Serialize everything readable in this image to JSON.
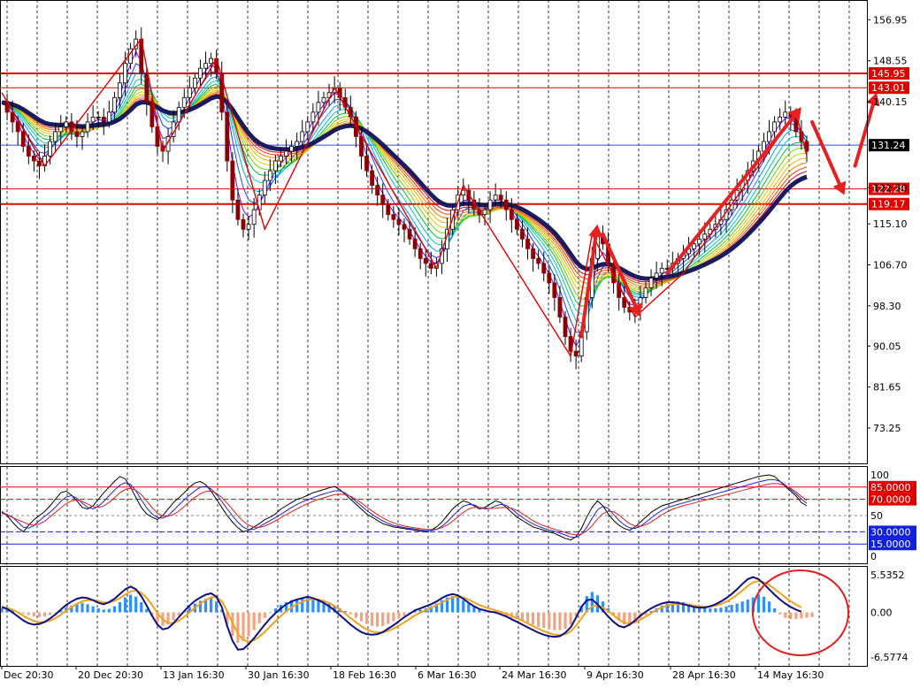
{
  "chart_data": [
    {
      "type": "candlestick",
      "panel": "price",
      "y_ticks": [
        "156.95",
        "148.55",
        "140.15",
        "122.50",
        "115.10",
        "106.70",
        "98.30",
        "90.05",
        "81.65",
        "73.25"
      ],
      "y_tick_values": [
        156.95,
        148.55,
        140.15,
        122.5,
        115.1,
        106.7,
        98.3,
        90.05,
        81.65,
        73.25
      ],
      "ylim": [
        66,
        161
      ],
      "grid": true,
      "current_price": {
        "label": "131.24",
        "value": 131.24
      },
      "horizontal_levels": [
        {
          "label": "145.95",
          "value": 145.95,
          "color": "#e00000"
        },
        {
          "label": "143.01",
          "value": 143.01,
          "color": "#e00000"
        },
        {
          "label": "122.28",
          "value": 122.28,
          "color": "#e00000"
        },
        {
          "label": "119.17",
          "value": 119.17,
          "color": "#e00000"
        }
      ],
      "zigzag_points": [
        {
          "bar": 0,
          "value": 142
        },
        {
          "bar": 8,
          "value": 127
        },
        {
          "bar": 26,
          "value": 153
        },
        {
          "bar": 30,
          "value": 130
        },
        {
          "bar": 40,
          "value": 149
        },
        {
          "bar": 49,
          "value": 114
        },
        {
          "bar": 62,
          "value": 143
        },
        {
          "bar": 81,
          "value": 106
        },
        {
          "bar": 86,
          "value": 123
        },
        {
          "bar": 106,
          "value": 88
        },
        {
          "bar": 110,
          "value": 113
        },
        {
          "bar": 118,
          "value": 96
        },
        {
          "bar": 127,
          "value": 105
        },
        {
          "bar": 148,
          "value": 138
        },
        {
          "bar": 150,
          "value": 129
        }
      ],
      "close_series": [
        140,
        138,
        136,
        134,
        131,
        129,
        128,
        127,
        129,
        132,
        134,
        135,
        136,
        134,
        133,
        134,
        136,
        137,
        137,
        136,
        138,
        141,
        144,
        148,
        151,
        153,
        146,
        140,
        135,
        131,
        130,
        133,
        136,
        139,
        141,
        143,
        145,
        147,
        148,
        149,
        146,
        138,
        128,
        120,
        116,
        114,
        115,
        118,
        121,
        124,
        126,
        128,
        129,
        130,
        131,
        132,
        134,
        136,
        138,
        140,
        141,
        142,
        143,
        141,
        139,
        137,
        133,
        129,
        126,
        123,
        121,
        119,
        117,
        116,
        115,
        114,
        112,
        110,
        108,
        107,
        106,
        107,
        110,
        114,
        118,
        121,
        122,
        120,
        118,
        117,
        118,
        120,
        121,
        120,
        118,
        116,
        114,
        112,
        110,
        108,
        107,
        105,
        103,
        100,
        96,
        92,
        89,
        88,
        93,
        100,
        108,
        113,
        111,
        107,
        103,
        100,
        98,
        97,
        98,
        100,
        102,
        104,
        105,
        106,
        106,
        107,
        108,
        109,
        110,
        111,
        112,
        113,
        114,
        115,
        116,
        118,
        120,
        122,
        124,
        126,
        128,
        130,
        132,
        134,
        136,
        137,
        138,
        137,
        134,
        132,
        130
      ],
      "ma_ribbon_count": 12,
      "thick_ma_color": "#1a1a5e",
      "arrows": [
        {
          "from_bar": 108,
          "from_value": 92,
          "to_bar": 111,
          "to_value": 115
        },
        {
          "from_bar": 112,
          "from_value": 113,
          "to_bar": 119,
          "to_value": 96
        },
        {
          "from_bar": 124,
          "from_value": 105,
          "to_bar": 149,
          "to_value": 139
        },
        {
          "from_bar": 151,
          "from_value": 136,
          "to_bar": 157,
          "to_value": 121
        },
        {
          "from_bar": 159,
          "from_value": 127,
          "to_bar": 163,
          "to_value": 142
        }
      ]
    },
    {
      "type": "line",
      "panel": "oscillator",
      "y_ticks": [
        "100",
        "50",
        "0"
      ],
      "ylim": [
        0,
        100
      ],
      "levels": [
        {
          "label": "85.0000",
          "value": 85,
          "color": "#e00000"
        },
        {
          "label": "70.0000",
          "value": 70,
          "color": "#e00000"
        },
        {
          "label": "30.0000",
          "value": 30,
          "color": "#1020e0"
        },
        {
          "label": "15.0000",
          "value": 15,
          "color": "#1020e0"
        }
      ],
      "series_colors": [
        "#000000",
        "#2020e0",
        "#e02020"
      ],
      "series": [
        {
          "values": [
            55,
            50,
            42,
            35,
            30,
            38,
            45,
            50,
            55,
            62,
            70,
            78,
            80,
            75,
            68,
            60,
            58,
            62,
            70,
            78,
            85,
            92,
            98,
            95,
            85,
            72,
            60,
            52,
            48,
            45,
            50,
            58,
            66,
            72,
            78,
            85,
            90,
            92,
            88,
            80,
            70,
            60,
            50,
            42,
            35,
            30,
            32,
            36,
            40,
            45,
            48,
            52,
            58,
            62,
            66,
            70,
            72,
            75,
            78,
            80,
            82,
            84,
            86,
            82,
            76,
            70,
            64,
            58,
            52,
            48,
            44,
            40,
            38,
            36,
            35,
            34,
            33,
            32,
            31,
            30,
            32,
            36,
            42,
            50,
            58,
            64,
            68,
            66,
            62,
            58,
            60,
            64,
            68,
            66,
            60,
            54,
            48,
            44,
            40,
            36,
            34,
            32,
            30,
            28,
            25,
            22,
            20,
            24,
            34,
            48,
            60,
            68,
            62,
            52,
            44,
            38,
            34,
            32,
            36,
            42,
            48,
            54,
            58,
            62,
            64,
            66,
            68,
            70,
            72,
            74,
            76,
            78,
            80,
            82,
            84,
            86,
            88,
            90,
            92,
            94,
            96,
            98,
            99,
            100,
            98,
            92,
            86,
            80,
            74,
            66,
            62
          ]
        }
      ]
    },
    {
      "type": "bar+line",
      "panel": "macd",
      "y_ticks": [
        "5.5352",
        "0.00",
        "-6.5774"
      ],
      "ylim": [
        -6.5774,
        5.5352
      ],
      "histogram": [
        0.6,
        0.5,
        0.3,
        0.1,
        -0.2,
        -0.4,
        -0.6,
        -0.7,
        -0.6,
        -0.4,
        -0.1,
        0.3,
        0.7,
        1.0,
        1.3,
        1.4,
        1.2,
        0.9,
        0.6,
        0.4,
        0.5,
        0.9,
        1.5,
        2.2,
        2.6,
        2.3,
        1.5,
        0.5,
        -0.6,
        -1.5,
        -2.0,
        -1.8,
        -1.2,
        -0.5,
        0.2,
        0.8,
        1.3,
        1.7,
        2.0,
        2.1,
        1.6,
        0.4,
        -1.8,
        -3.5,
        -4.5,
        -4.2,
        -3.5,
        -2.6,
        -1.6,
        -0.8,
        0.0,
        0.6,
        1.1,
        1.5,
        1.8,
        2.0,
        2.1,
        2.2,
        2.0,
        1.8,
        1.6,
        1.3,
        1.0,
        0.6,
        0.2,
        -0.3,
        -0.8,
        -1.3,
        -1.7,
        -2.0,
        -2.1,
        -2.0,
        -1.7,
        -1.3,
        -0.9,
        -0.5,
        -0.1,
        0.2,
        0.4,
        0.6,
        0.9,
        1.3,
        1.8,
        2.2,
        2.4,
        2.2,
        1.8,
        1.3,
        0.8,
        0.4,
        0.1,
        -0.1,
        -0.2,
        -0.3,
        -0.5,
        -0.8,
        -1.0,
        -1.2,
        -1.5,
        -1.8,
        -2.1,
        -2.3,
        -2.5,
        -2.6,
        -2.6,
        -2.4,
        -1.8,
        -0.6,
        1.0,
        2.4,
        3.0,
        2.5,
        1.6,
        0.6,
        -0.4,
        -1.2,
        -1.8,
        -2.0,
        -1.6,
        -1.0,
        -0.4,
        0.2,
        0.6,
        1.0,
        1.3,
        1.5,
        1.6,
        1.5,
        1.3,
        1.1,
        0.9,
        0.7,
        0.6,
        0.6,
        0.7,
        0.9,
        1.1,
        1.3,
        1.6,
        1.9,
        2.2,
        2.5,
        2.3,
        1.6,
        0.6,
        -0.3,
        -0.8,
        -1.0,
        -1.0,
        -0.9,
        -0.8,
        -0.7
      ],
      "macd_line": [
        0.8,
        0.5,
        0.0,
        -0.6,
        -1.2,
        -1.6,
        -1.8,
        -1.7,
        -1.4,
        -0.9,
        -0.3,
        0.4,
        1.1,
        1.6,
        2.0,
        2.2,
        2.1,
        1.8,
        1.4,
        1.2,
        1.5,
        2.0,
        2.7,
        3.4,
        3.8,
        3.4,
        2.4,
        1.0,
        -0.5,
        -1.8,
        -2.5,
        -2.3,
        -1.6,
        -0.7,
        0.2,
        1.0,
        1.7,
        2.2,
        2.6,
        2.8,
        2.3,
        0.8,
        -2.0,
        -4.2,
        -5.5,
        -5.4,
        -4.7,
        -3.8,
        -2.8,
        -1.8,
        -0.9,
        -0.1,
        0.6,
        1.2,
        1.6,
        1.9,
        2.1,
        2.3,
        2.1,
        1.8,
        1.4,
        0.9,
        0.3,
        -0.4,
        -1.1,
        -1.8,
        -2.4,
        -2.9,
        -3.2,
        -3.3,
        -3.2,
        -2.9,
        -2.4,
        -1.9,
        -1.3,
        -0.7,
        -0.2,
        0.3,
        0.6,
        0.9,
        1.2,
        1.6,
        2.1,
        2.5,
        2.7,
        2.5,
        2.0,
        1.4,
        0.9,
        0.5,
        0.3,
        0.1,
        0.0,
        -0.3,
        -0.6,
        -1.0,
        -1.4,
        -1.8,
        -2.2,
        -2.6,
        -3.0,
        -3.3,
        -3.5,
        -3.6,
        -3.5,
        -3.0,
        -2.2,
        -0.8,
        0.8,
        1.8,
        1.9,
        1.2,
        0.3,
        -0.6,
        -1.4,
        -2.0,
        -2.2,
        -1.8,
        -1.2,
        -0.5,
        0.1,
        0.6,
        1.0,
        1.3,
        1.5,
        1.5,
        1.4,
        1.2,
        1.0,
        0.8,
        0.7,
        0.7,
        0.9,
        1.2,
        1.6,
        2.1,
        2.7,
        3.4,
        4.2,
        4.9,
        5.2,
        4.9,
        4.2,
        3.4,
        2.6,
        1.9,
        1.3,
        0.8,
        0.4,
        0.1
      ]
    }
  ],
  "x_axis_labels": [
    "Dec 20:30",
    "20 Dec 20:30",
    "13 Jan 16:30",
    "30 Jan 16:30",
    "18 Feb 16:30",
    "6 Mar 16:30",
    "24 Mar 16:30",
    "9 Apr 16:30",
    "28 Apr 16:30",
    "14 May 16:30"
  ],
  "colors": {
    "grid": "#1a1a1a",
    "border": "#000000",
    "level_red": "#e00000",
    "level_blue": "#1020e0",
    "hist_pos": "#2f8fff",
    "hist_neg": "#f4a27f",
    "macd": "#101080",
    "signal": "#f2a11e"
  }
}
